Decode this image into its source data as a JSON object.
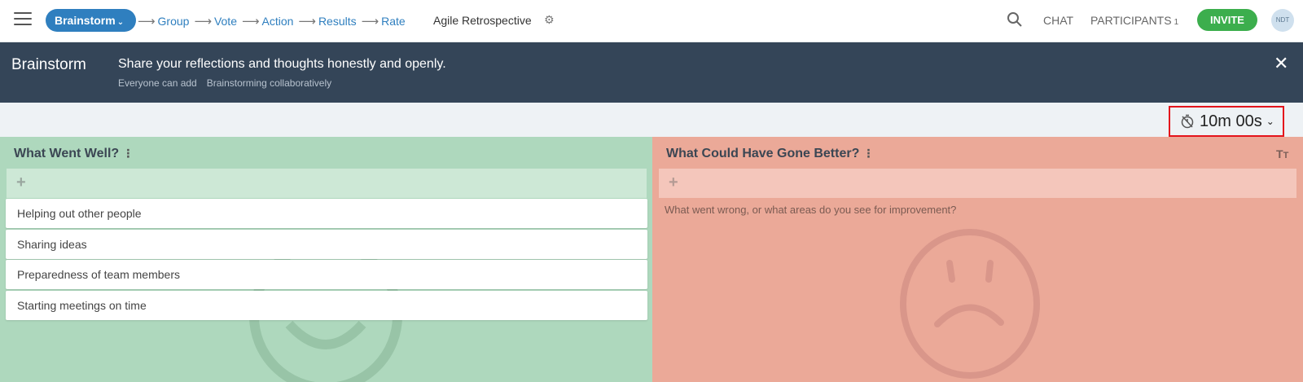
{
  "header": {
    "current_step": "Brainstorm",
    "steps": [
      "Group",
      "Vote",
      "Action",
      "Results",
      "Rate"
    ],
    "retro_title": "Agile Retrospective",
    "chat_label": "CHAT",
    "participants_label": "PARTICIPANTS",
    "participants_count": "1",
    "invite_label": "INVITE",
    "avatar_initials": "NDT"
  },
  "banner": {
    "title": "Brainstorm",
    "description": "Share your reflections and thoughts honestly and openly.",
    "meta": [
      "Everyone can add",
      "Brainstorming collaboratively"
    ]
  },
  "timer": {
    "value": "10m 00s"
  },
  "columns": [
    {
      "title": "What Went Well?",
      "color": "#aed8bd",
      "cards": [
        "Helping out other people",
        "Sharing ideas",
        "Preparedness of team members",
        "Starting meetings on time"
      ]
    },
    {
      "title": "What Could Have Gone Better?",
      "color": "#eba998",
      "placeholder": "What went wrong, or what areas do you see for improvement?",
      "cards": []
    }
  ],
  "colors": {
    "accent": "#2f7fbf",
    "invite": "#3cae4d",
    "banner": "#344558",
    "highlight": "#e4151c"
  },
  "icons": [
    "menu-icon",
    "chevron-down-icon",
    "arrow-right-icon",
    "gear-icon",
    "search-icon",
    "close-icon",
    "stopwatch-icon",
    "kebab-icon",
    "plus-icon",
    "text-size-icon",
    "smiley-face-icon",
    "sad-face-icon"
  ]
}
